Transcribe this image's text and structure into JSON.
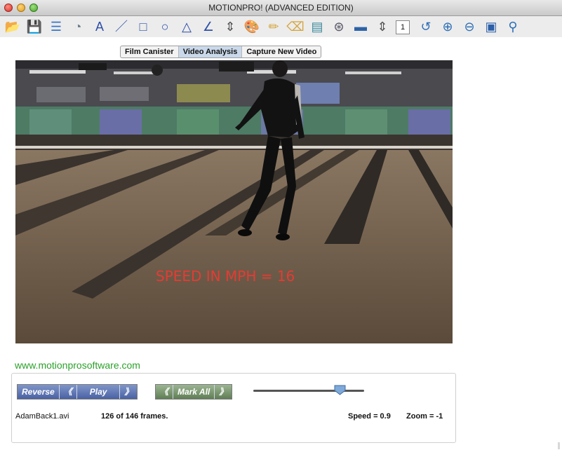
{
  "window": {
    "title": "MOTIONPRO! (ADVANCED EDITION)"
  },
  "toolbar": {
    "items": [
      {
        "name": "open-folder-icon",
        "glyph": "📂"
      },
      {
        "name": "save-icon",
        "glyph": "💾"
      },
      {
        "name": "list-icon",
        "glyph": "☰"
      },
      {
        "name": "protractor-icon",
        "glyph": "◔"
      },
      {
        "name": "text-tool-icon",
        "glyph": "A"
      },
      {
        "name": "line-tool-icon",
        "glyph": "／"
      },
      {
        "name": "rectangle-tool-icon",
        "glyph": "□"
      },
      {
        "name": "circle-tool-icon",
        "glyph": "○"
      },
      {
        "name": "triangle-tool-icon",
        "glyph": "△"
      },
      {
        "name": "angle-tool-icon",
        "glyph": "∠"
      },
      {
        "name": "stepper-icon",
        "glyph": "⇕"
      },
      {
        "name": "palette-icon",
        "glyph": "🎨"
      },
      {
        "name": "pencil-icon",
        "glyph": "✏"
      },
      {
        "name": "eraser-icon",
        "glyph": "⌫"
      },
      {
        "name": "clear-icon",
        "glyph": "▤"
      },
      {
        "name": "reel-icon",
        "glyph": "⊛"
      },
      {
        "name": "screen-icon",
        "glyph": "▬"
      },
      {
        "name": "stepper-icon-2",
        "glyph": "⇕"
      },
      {
        "name": "frame-step-value",
        "glyph": "1"
      },
      {
        "name": "path-icon",
        "glyph": "↺"
      },
      {
        "name": "zoom-in-icon",
        "glyph": "⊕"
      },
      {
        "name": "zoom-out-icon",
        "glyph": "⊖"
      },
      {
        "name": "monitor-icon",
        "glyph": "▣"
      },
      {
        "name": "search-icon",
        "glyph": "⚲"
      }
    ]
  },
  "tabs": [
    {
      "label": "Film Canister",
      "active": false
    },
    {
      "label": "Video Analysis",
      "active": true
    },
    {
      "label": "Capture New Video",
      "active": false
    }
  ],
  "video": {
    "overlay_text": "SPEED IN MPH = 16"
  },
  "footer": {
    "url": "www.motionprosoftware.com",
    "playback": {
      "reverse": "Reverse",
      "rewind": "《",
      "play": "Play",
      "forward": "》"
    },
    "mark": {
      "prev": "《",
      "label": "Mark All",
      "next": "》"
    },
    "slider_position": 0.78,
    "filename": "AdamBack1.avi",
    "frames": "126 of 146 frames.",
    "speed": "Speed = 0.9",
    "zoom": "Zoom = -1"
  },
  "colors": {
    "speed_text": "#e63b33",
    "url": "#2ba12b",
    "play_group": "#4a62a4",
    "mark_group": "#5f7e55"
  }
}
